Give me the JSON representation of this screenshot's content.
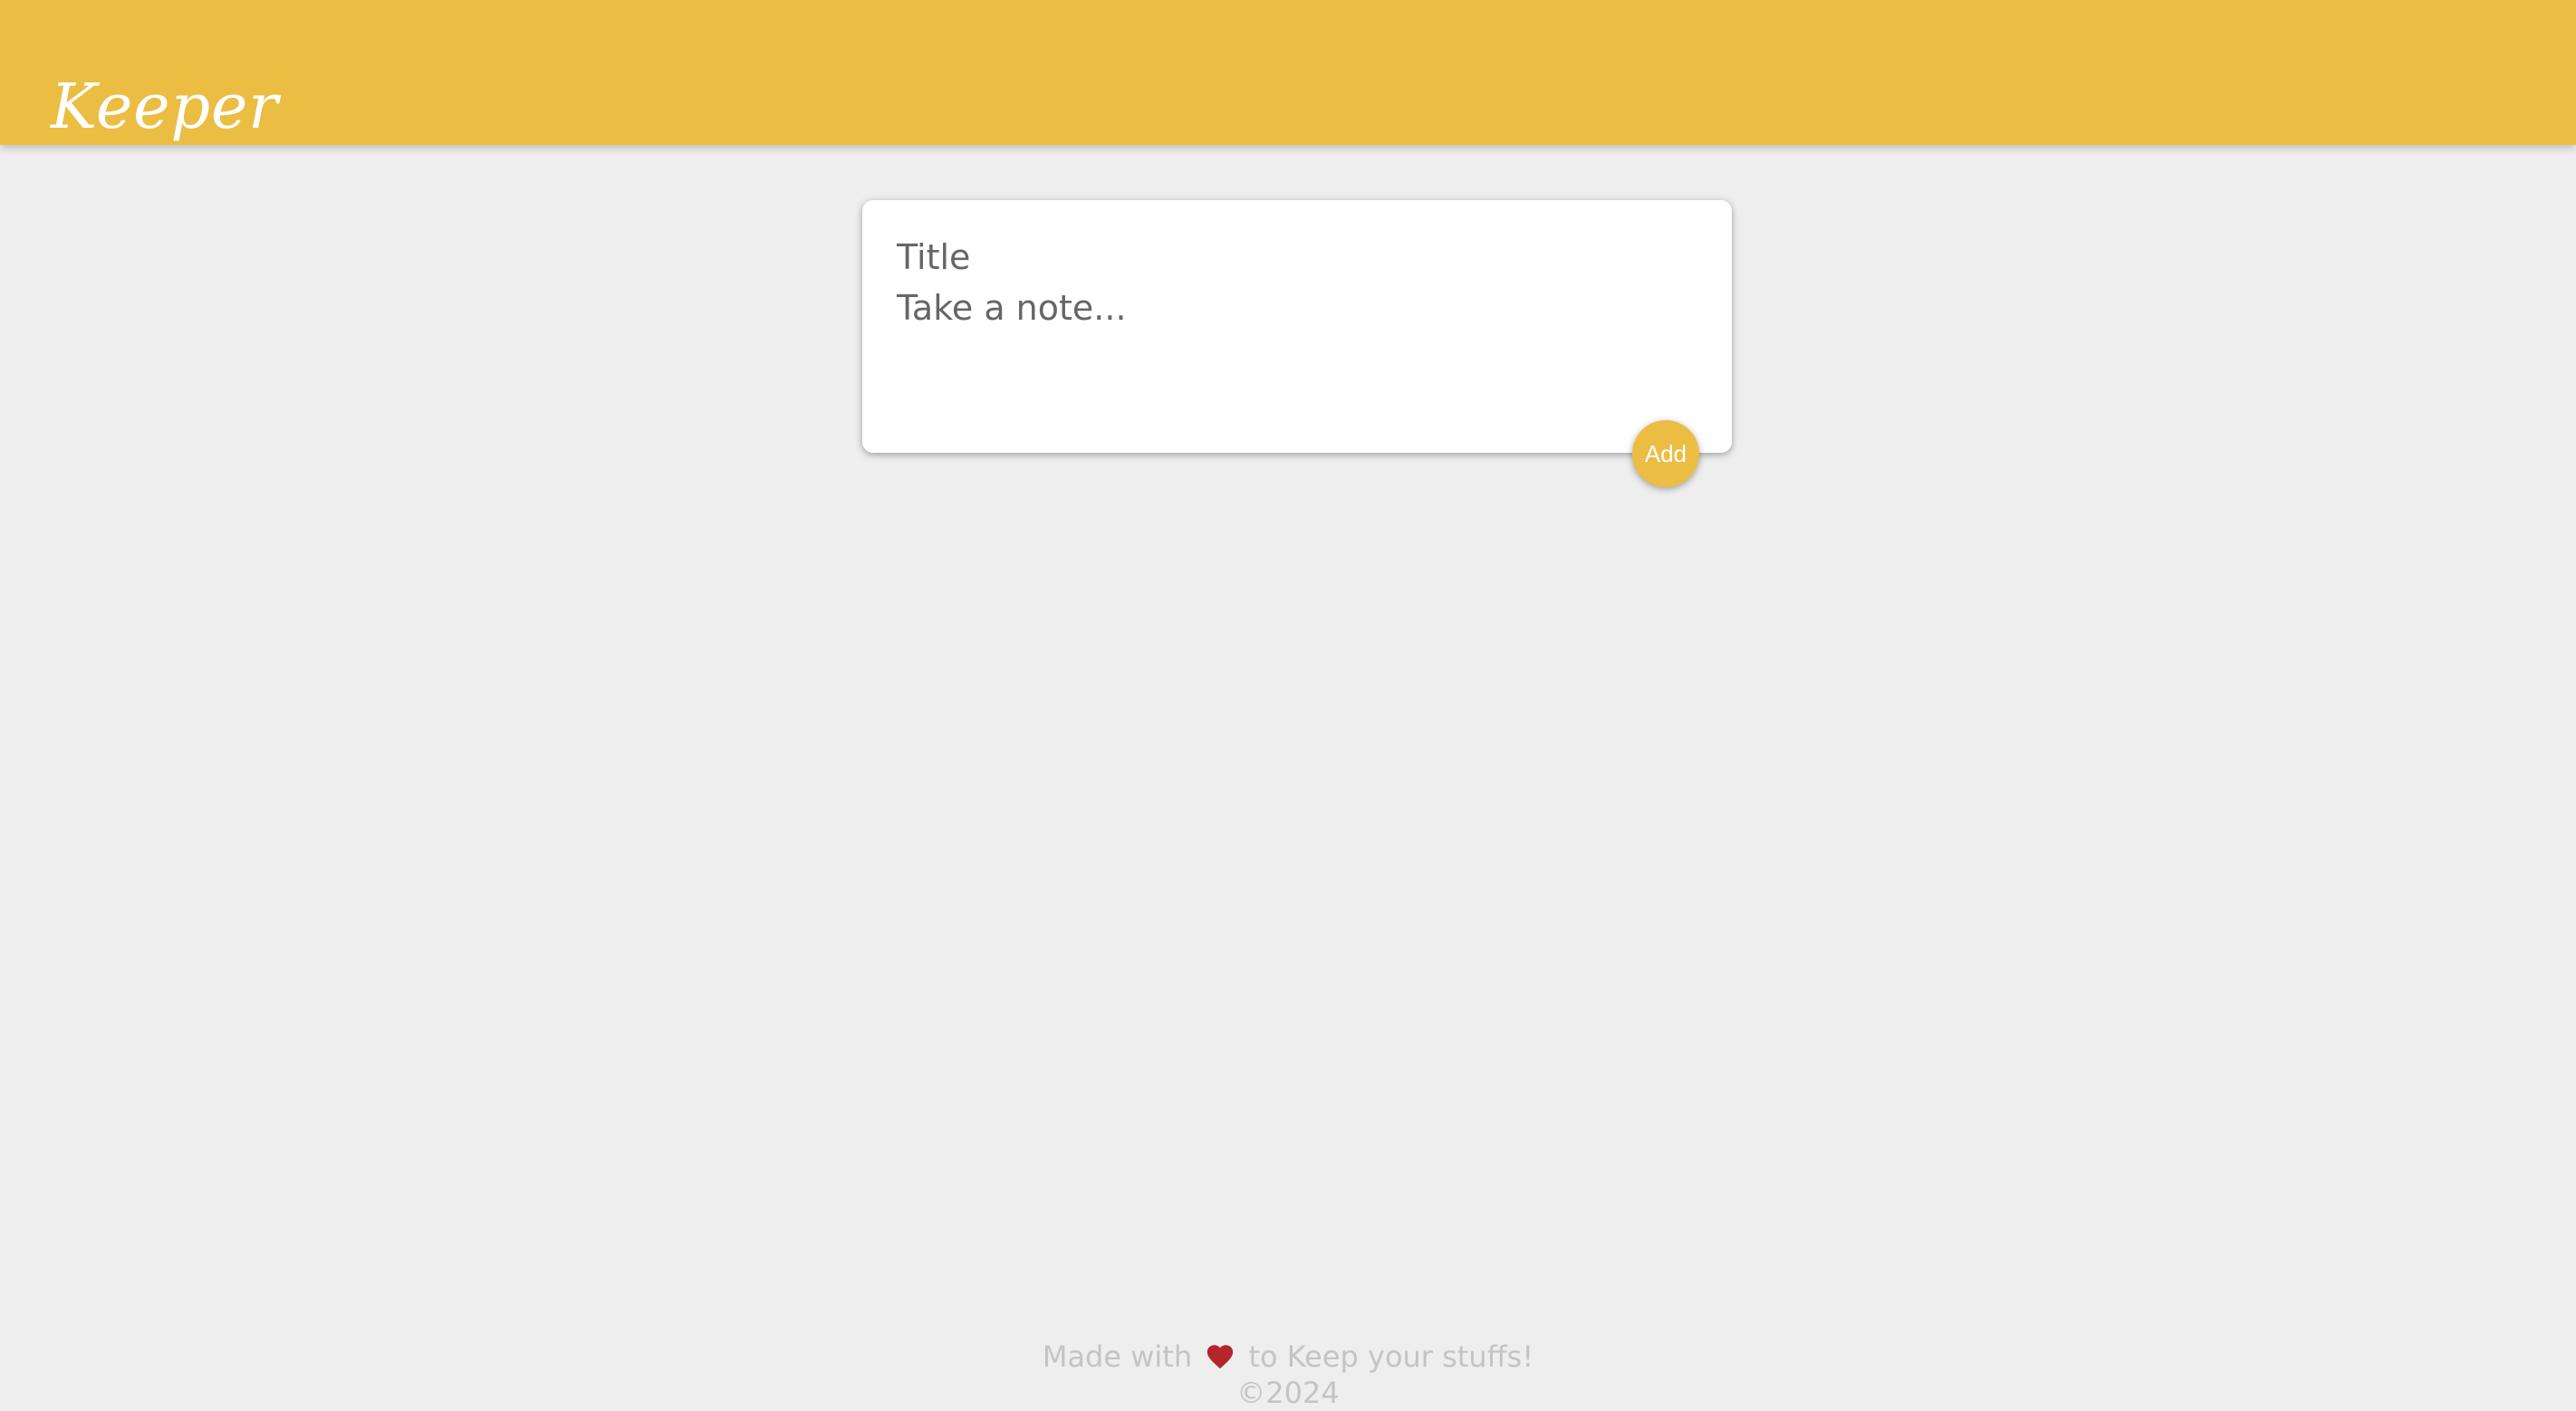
{
  "header": {
    "app_name": "Keeper",
    "accent_color": "#ebbd43"
  },
  "note_form": {
    "title_placeholder": "Title",
    "content_placeholder": "Take a note...",
    "add_button_label": "Add"
  },
  "footer": {
    "made_with_text": "Made with",
    "heart_icon": "heart-icon",
    "tagline_suffix": "to Keep your stuffs!",
    "copyright": "©2024"
  }
}
